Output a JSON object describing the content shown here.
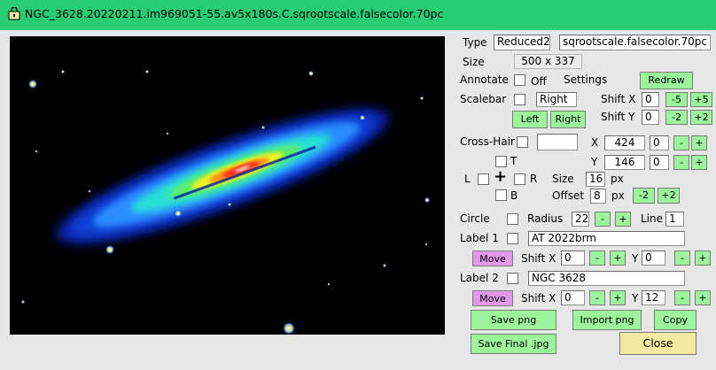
{
  "window": {
    "title": "NGC_3628.20220211.im969051-55.av5x180s.C.sqrootscale.falsecolor.70pc",
    "icon": "folder-lock-icon",
    "title_bar_color": "#27cc73"
  },
  "type": {
    "label": "Type",
    "value": "Reduced2",
    "scale_value": "sqrootscale.falsecolor.70pc"
  },
  "size": {
    "label": "Size",
    "value": "500 x 337"
  },
  "annotate": {
    "label": "Annotate",
    "state": "Off",
    "settings_label": "Settings",
    "redraw_label": "Redraw"
  },
  "scalebar": {
    "label": "Scalebar",
    "position": "Right",
    "left_label": "Left",
    "right_label": "Right",
    "shift_x_label": "Shift X",
    "shift_x": "0",
    "shift_y_label": "Shift Y",
    "shift_y": "0",
    "minus5": "-5",
    "plus5": "+5",
    "minus2": "-2",
    "plus2": "+2"
  },
  "crosshair": {
    "label": "Cross-Hair",
    "text": "",
    "x_label": "X",
    "x": "424",
    "x_step": "0",
    "y_label": "Y",
    "y": "146",
    "y_step": "0",
    "minus": "-",
    "plus": "+",
    "t_label": "T",
    "l_label": "L",
    "r_label": "R",
    "b_label": "B",
    "center_symbol": "+",
    "size_label": "Size",
    "size": "16",
    "px_unit": "px",
    "offset_label": "Offset",
    "offset": "8",
    "offset_minus": "-2",
    "offset_plus": "+2"
  },
  "circle": {
    "label": "Circle",
    "radius_label": "Radius",
    "radius": "22",
    "minus": "-",
    "plus": "+",
    "line_label": "Line",
    "line": "1"
  },
  "label1": {
    "label": "Label 1",
    "text": "AT 2022brm",
    "move_label": "Move",
    "shift_x_label": "Shift X",
    "shift_x": "0",
    "y_label": "Y",
    "y": "0",
    "minus": "-",
    "plus": "+"
  },
  "label2": {
    "label": "Label 2",
    "text": "NGC 3628",
    "move_label": "Move",
    "shift_x_label": "Shift X",
    "shift_x": "0",
    "y_label": "Y",
    "y": "12",
    "minus": "-",
    "plus": "+"
  },
  "actions": {
    "save_png": "Save png",
    "import_png": "Import png",
    "copy": "Copy",
    "save_final": "Save Final .jpg",
    "close": "Close"
  },
  "colors": {
    "button_green": "#9cf59c",
    "button_pink": "#e29ae8",
    "button_yellow": "#f3e9a3",
    "background": "#e7e7e7"
  }
}
